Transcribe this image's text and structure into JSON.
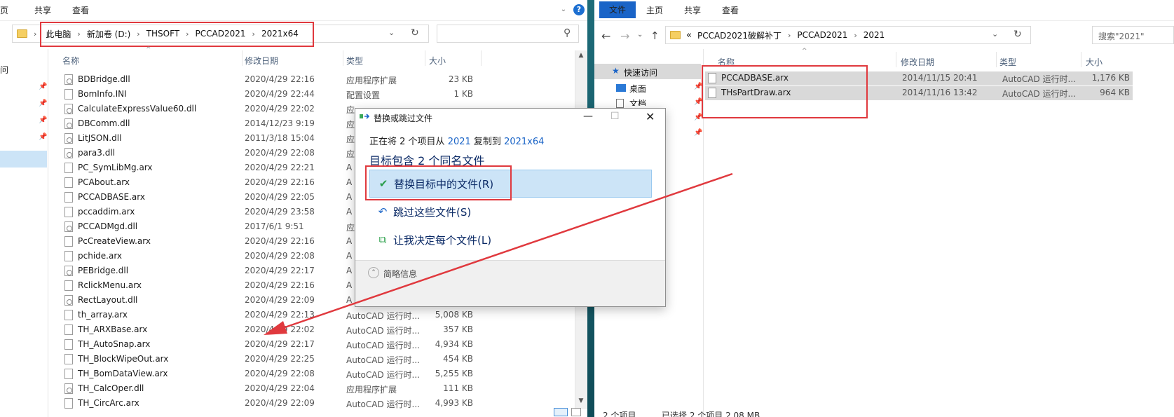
{
  "left": {
    "ribbon_tabs": [
      "页",
      "共享",
      "查看"
    ],
    "breadcrumb": [
      "此电脑",
      "新加卷 (D:)",
      "THSOFT",
      "PCCAD2021",
      "2021x64"
    ],
    "columns": [
      "名称",
      "修改日期",
      "类型",
      "大小"
    ],
    "nav_fragment": "问",
    "rows": [
      {
        "name": "BDBridge.dll",
        "date": "2020/4/29 22:16",
        "type": "应用程序扩展",
        "size": "23 KB"
      },
      {
        "name": "BomInfo.INI",
        "date": "2020/4/29 22:44",
        "type": "配置设置",
        "size": "1 KB"
      },
      {
        "name": "CalculateExpressValue60.dll",
        "date": "2020/4/29 22:02",
        "type": "应",
        "size": ""
      },
      {
        "name": "DBComm.dll",
        "date": "2014/12/23 9:19",
        "type": "应",
        "size": ""
      },
      {
        "name": "LitJSON.dll",
        "date": "2011/3/18 15:04",
        "type": "应",
        "size": ""
      },
      {
        "name": "para3.dll",
        "date": "2020/4/29 22:08",
        "type": "应",
        "size": ""
      },
      {
        "name": "PC_SymLibMg.arx",
        "date": "2020/4/29 22:21",
        "type": "A",
        "size": ""
      },
      {
        "name": "PCAbout.arx",
        "date": "2020/4/29 22:16",
        "type": "A",
        "size": ""
      },
      {
        "name": "PCCADBASE.arx",
        "date": "2020/4/29 22:05",
        "type": "A",
        "size": ""
      },
      {
        "name": "pccaddim.arx",
        "date": "2020/4/29 23:58",
        "type": "A",
        "size": ""
      },
      {
        "name": "PCCADMgd.dll",
        "date": "2017/6/1 9:51",
        "type": "应",
        "size": ""
      },
      {
        "name": "PcCreateView.arx",
        "date": "2020/4/29 22:16",
        "type": "A",
        "size": ""
      },
      {
        "name": "pchide.arx",
        "date": "2020/4/29 22:08",
        "type": "A",
        "size": ""
      },
      {
        "name": "PEBridge.dll",
        "date": "2020/4/29 22:17",
        "type": "A",
        "size": ""
      },
      {
        "name": "RclickMenu.arx",
        "date": "2020/4/29 22:16",
        "type": "A",
        "size": ""
      },
      {
        "name": "RectLayout.dll",
        "date": "2020/4/29 22:09",
        "type": "A",
        "size": ""
      },
      {
        "name": "th_array.arx",
        "date": "2020/4/29 22:13",
        "type": "AutoCAD 运行时...",
        "size": "5,008 KB"
      },
      {
        "name": "TH_ARXBase.arx",
        "date": "2020/4/29 22:02",
        "type": "AutoCAD 运行时...",
        "size": "357 KB"
      },
      {
        "name": "TH_AutoSnap.arx",
        "date": "2020/4/29 22:17",
        "type": "AutoCAD 运行时...",
        "size": "4,934 KB"
      },
      {
        "name": "TH_BlockWipeOut.arx",
        "date": "2020/4/29 22:25",
        "type": "AutoCAD 运行时...",
        "size": "454 KB"
      },
      {
        "name": "TH_BomDataView.arx",
        "date": "2020/4/29 22:08",
        "type": "AutoCAD 运行时...",
        "size": "5,255 KB"
      },
      {
        "name": "TH_CalcOper.dll",
        "date": "2020/4/29 22:04",
        "type": "应用程序扩展",
        "size": "111 KB"
      },
      {
        "name": "TH_CircArc.arx",
        "date": "2020/4/29 22:09",
        "type": "AutoCAD 运行时...",
        "size": "4,993 KB"
      }
    ]
  },
  "right": {
    "ribbon_tabs": [
      "文件",
      "主页",
      "共享",
      "查看"
    ],
    "breadcrumb": [
      "PCCAD2021破解补丁",
      "PCCAD2021",
      "2021"
    ],
    "breadcrumb_prefix": "«",
    "search_placeholder": "搜索\"2021\"",
    "columns": [
      "名称",
      "修改日期",
      "类型",
      "大小"
    ],
    "nav": [
      "快速访问",
      "桌面",
      "文档"
    ],
    "rows": [
      {
        "name": "PCCADBASE.arx",
        "date": "2014/11/15 20:41",
        "type": "AutoCAD 运行时...",
        "size": "1,176 KB"
      },
      {
        "name": "THsPartDraw.arx",
        "date": "2014/11/16 13:42",
        "type": "AutoCAD 运行时...",
        "size": "964 KB"
      }
    ],
    "status": [
      "2 个项目",
      "已选择 2 个项目 2.08 MB"
    ]
  },
  "dialog": {
    "title": "替换或跳过文件",
    "line1_pre": "正在将 2 个项目从",
    "line1_src": "2021",
    "line1_mid": "复制到",
    "line1_dst": "2021x64",
    "heading": "目标包含 2 个同名文件",
    "options": [
      "替换目标中的文件(R)",
      "跳过这些文件(S)",
      "让我决定每个文件(L)"
    ],
    "details": "简略信息"
  },
  "colors": {
    "accent": "#1a64c7",
    "highlight_box": "#e0393e",
    "selected_option": "#cce4f7"
  }
}
